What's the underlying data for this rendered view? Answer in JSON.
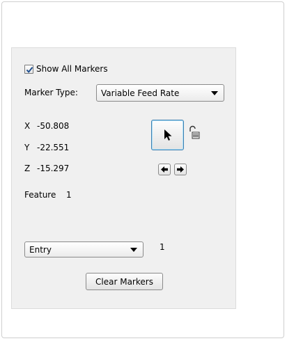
{
  "markers_panel": {
    "show_all_markers": {
      "label": "Show All Markers",
      "checked": true
    },
    "marker_type": {
      "label": "Marker Type:",
      "selected": "Variable Feed Rate"
    },
    "coordinates": {
      "x": {
        "label": "X",
        "value": "-50.808"
      },
      "y": {
        "label": "Y",
        "value": "-22.551"
      },
      "z": {
        "label": "Z",
        "value": "-15.297"
      }
    },
    "feature": {
      "label": "Feature",
      "value": "1"
    },
    "point_select": {
      "selected": "Entry",
      "index": "1"
    },
    "clear_markers_label": "Clear Markers",
    "icons": {
      "pointer": "pointer-arrow-icon",
      "lock": "unlocked-padlock-icon",
      "prev": "arrow-left-icon",
      "next": "arrow-right-icon"
    },
    "colors": {
      "panel_bg": "#f0f0f0",
      "focus_border": "#3c7fb1",
      "checkbox_check": "#1f4f8f"
    }
  }
}
